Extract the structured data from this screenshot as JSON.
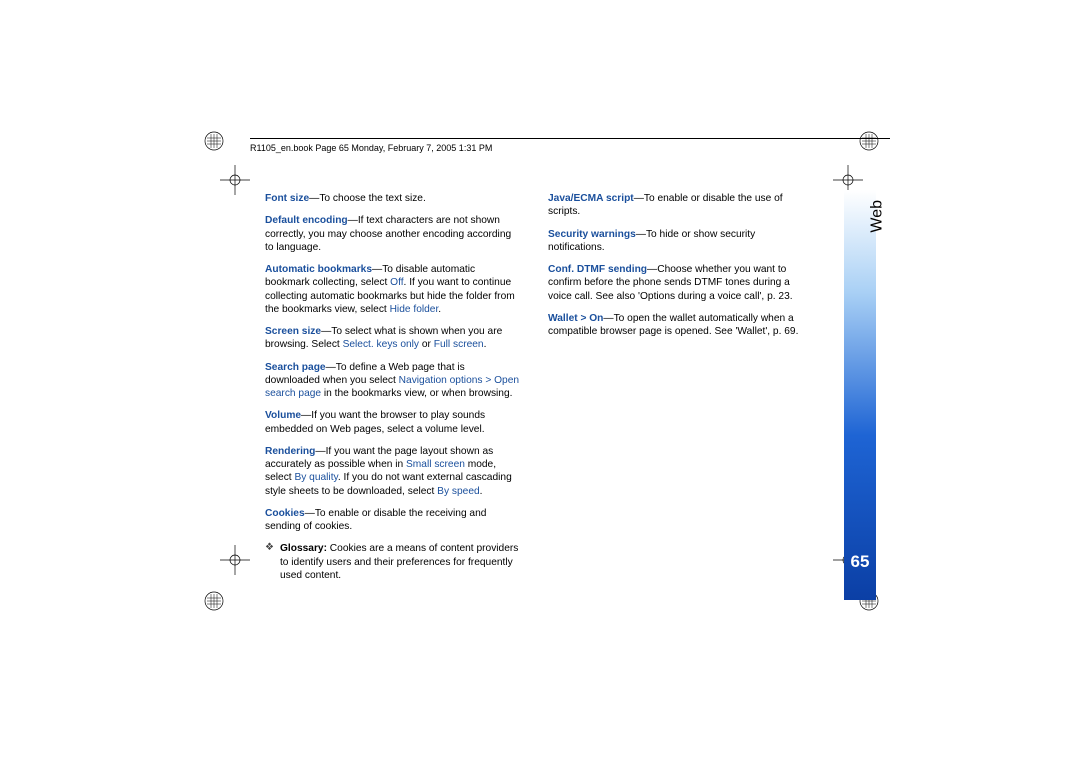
{
  "header": "R1105_en.book  Page 65  Monday, February 7, 2005  1:31 PM",
  "side_label": "Web",
  "page_number": "65",
  "left": {
    "font_size": {
      "kw": "Font size",
      "txt": "—To choose the text size."
    },
    "default_encoding": {
      "kw": "Default encoding",
      "txt": "—If text characters are not shown correctly, you may choose another encoding according to language."
    },
    "auto_bookmarks": {
      "kw": "Automatic bookmarks",
      "t1": "—To disable automatic bookmark collecting, select ",
      "off": "Off",
      "t2": ". If you want to continue collecting automatic bookmarks but hide the folder from the bookmarks view, select ",
      "hide": "Hide folder",
      "t3": "."
    },
    "screen_size": {
      "kw": "Screen size",
      "t1": "—To select what is shown when you are browsing. Select ",
      "opt1": "Select. keys only",
      "or": " or ",
      "opt2": "Full screen",
      "t2": "."
    },
    "search_page": {
      "kw": "Search page",
      "t1": "—To define a Web page that is downloaded when you select ",
      "nav": "Navigation options > Open search page",
      "t2": " in the bookmarks view, or when browsing."
    },
    "volume": {
      "kw": "Volume",
      "txt": "—If you want the browser to play sounds embedded on Web pages, select a volume level."
    },
    "rendering": {
      "kw": "Rendering",
      "t1": "—If you want the page layout shown as accurately as possible when in ",
      "sm": "Small screen",
      "t2": " mode, select ",
      "bq": "By quality",
      "t3": ". If you do not want external cascading style sheets to be downloaded, select ",
      "bs": "By speed",
      "t4": "."
    },
    "cookies": {
      "kw": "Cookies",
      "txt": "—To enable or disable the receiving and sending of cookies."
    },
    "glossary": {
      "label": "Glossary:",
      "txt": " Cookies are a means of content providers to identify users and their preferences for frequently used content."
    }
  },
  "right": {
    "java": {
      "kw": "Java/ECMA script",
      "txt": "—To enable or disable the use of scripts."
    },
    "security": {
      "kw": "Security warnings",
      "txt": "—To hide or show security notifications."
    },
    "dtmf": {
      "kw": "Conf. DTMF sending",
      "txt": "—Choose whether you want to confirm before the phone sends DTMF tones during a voice call. See also 'Options during a voice call', p. 23."
    },
    "wallet": {
      "kw": "Wallet > On",
      "txt": "—To open the wallet automatically when a compatible browser page is opened. See 'Wallet', p. 69."
    }
  }
}
